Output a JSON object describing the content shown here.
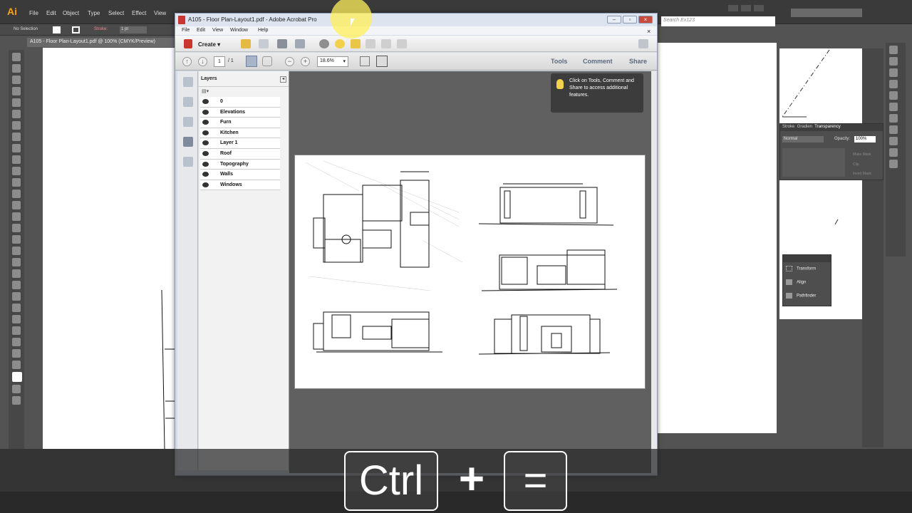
{
  "illustrator": {
    "logo": "Ai",
    "menus": [
      "File",
      "Edit",
      "Object",
      "Type",
      "Select",
      "Effect",
      "View"
    ],
    "selection_label": "No Selection",
    "stroke_label": "Stroke:",
    "stroke_value": "1 pt",
    "doc_tab": "A105 - Floor Plan-Layout1.pdf @ 100% (CMYK/Preview)",
    "search_placeholder": "Search Ex123",
    "transparency_panel": {
      "tabs": [
        "Stroke",
        "Gradien",
        "Transparency"
      ],
      "blend_mode": "Normal",
      "opacity_label": "Opacity:",
      "opacity_value": "100%",
      "options": [
        "Make Mask",
        "Clip",
        "Invert Mask"
      ]
    },
    "pathfinder_panel": {
      "items": [
        "Transform",
        "Align",
        "Pathfinder"
      ]
    }
  },
  "acrobat": {
    "title": "A105 - Floor Plan-Layout1.pdf - Adobe Acrobat Pro",
    "menus": [
      "File",
      "Edit",
      "View",
      "Window",
      "Help"
    ],
    "create_label": "Create",
    "page_current": "1",
    "page_total": "/ 1",
    "zoom": "18.6%",
    "right_links": [
      "Tools",
      "Comment",
      "Share"
    ],
    "layers_title": "Layers",
    "layers": [
      "0",
      "Elevations",
      "Furn",
      "Kitchen",
      "Layer 1",
      "Roof",
      "Topography",
      "Walls",
      "Windows"
    ],
    "tip_text": "Click on Tools, Comment and Share to access additional features."
  },
  "keystroke": {
    "key1": "Ctrl",
    "plus": "+",
    "key2": "="
  },
  "colors": {
    "ai_accent": "#f7a21c",
    "cursor_highlight": "#fff05a"
  }
}
